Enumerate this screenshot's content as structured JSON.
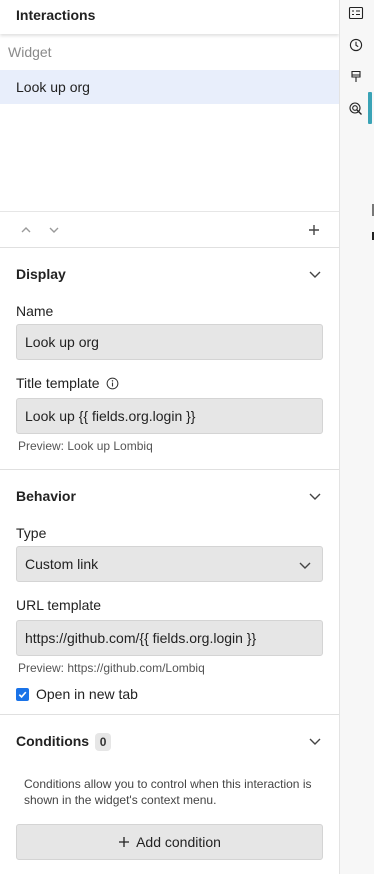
{
  "panel": {
    "title": "Interactions"
  },
  "list": {
    "group_label": "Widget",
    "items": [
      {
        "label": "Look up org",
        "selected": true
      }
    ]
  },
  "toolbar": {
    "move_up_icon": "chevron-up-icon",
    "move_down_icon": "chevron-down-icon",
    "add_icon": "plus-icon"
  },
  "display": {
    "title": "Display",
    "name_label": "Name",
    "name_value": "Look up org",
    "title_template_label": "Title template",
    "title_template_value": "Look up {{ fields.org.login }}",
    "title_preview": "Preview: Look up Lombiq"
  },
  "behavior": {
    "title": "Behavior",
    "type_label": "Type",
    "type_value": "Custom link",
    "url_template_label": "URL template",
    "url_template_value": "https://github.com/{{ fields.org.login }}",
    "url_preview": "Preview: https://github.com/Lombiq",
    "open_new_tab_label": "Open in new tab",
    "open_new_tab_checked": true
  },
  "conditions": {
    "title": "Conditions",
    "count": "0",
    "help": "Conditions allow you to control when this interaction is shown in the widget's context menu.",
    "add_label": "Add condition"
  },
  "rail": {
    "icons": [
      "list-details-icon",
      "history-icon",
      "brush-icon",
      "interaction-icon"
    ],
    "accent": "#3aa3b6"
  },
  "colors": {
    "selected_row": "#e8eefb",
    "checkbox": "#1a73e8"
  }
}
